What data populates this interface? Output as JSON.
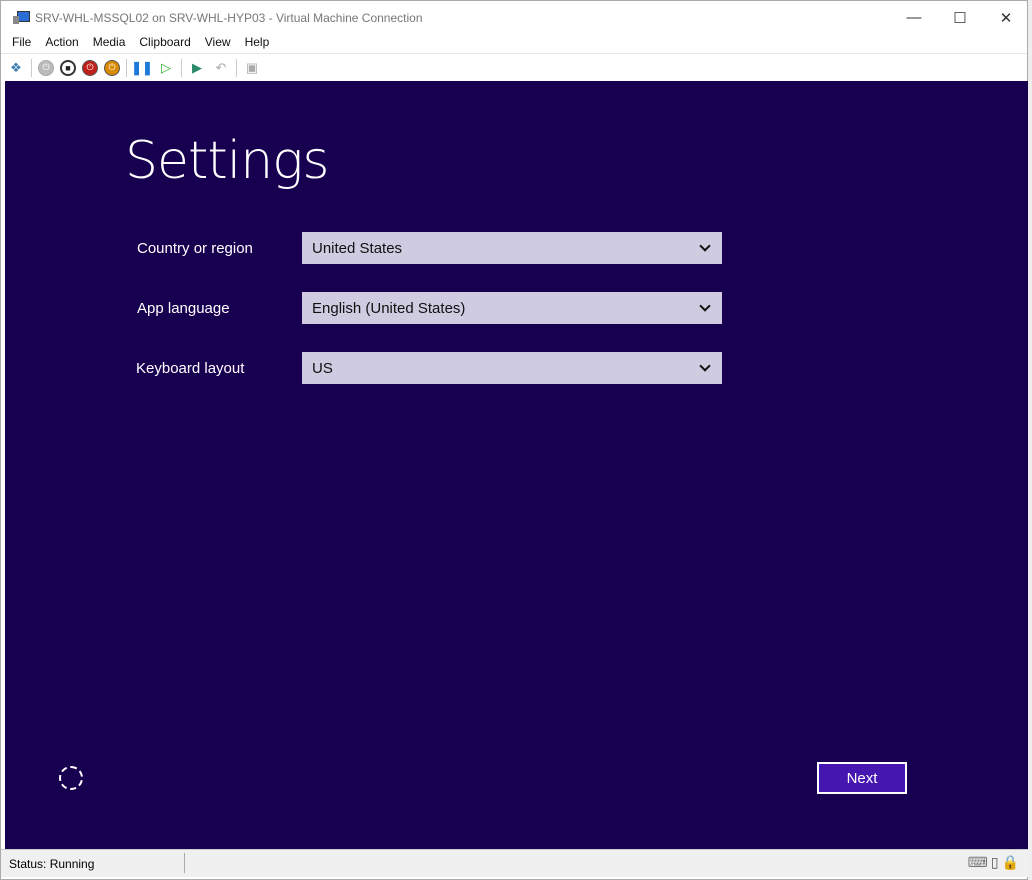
{
  "window": {
    "title": "SRV-WHL-MSSQL02 on SRV-WHL-HYP03 - Virtual Machine Connection"
  },
  "menu": [
    "File",
    "Action",
    "Media",
    "Clipboard",
    "View",
    "Help"
  ],
  "toolbar": [
    "ctrl-alt-del-icon",
    "start-icon",
    "turn-off-icon",
    "shutdown-icon",
    "power-icon",
    "pause-icon",
    "resume-icon",
    "checkpoint-icon",
    "revert-icon",
    "enhanced-session-icon"
  ],
  "setup": {
    "title": "Settings",
    "fields": [
      {
        "label": "Country or region",
        "value": "United States"
      },
      {
        "label": "App language",
        "value": "English (United States)"
      },
      {
        "label": "Keyboard layout",
        "value": "US"
      }
    ],
    "next_label": "Next"
  },
  "status": {
    "text": "Status: Running"
  },
  "colors": {
    "vm_bg": "#180050",
    "accent": "#4616b0",
    "dropdown": "#cfcbe0"
  }
}
